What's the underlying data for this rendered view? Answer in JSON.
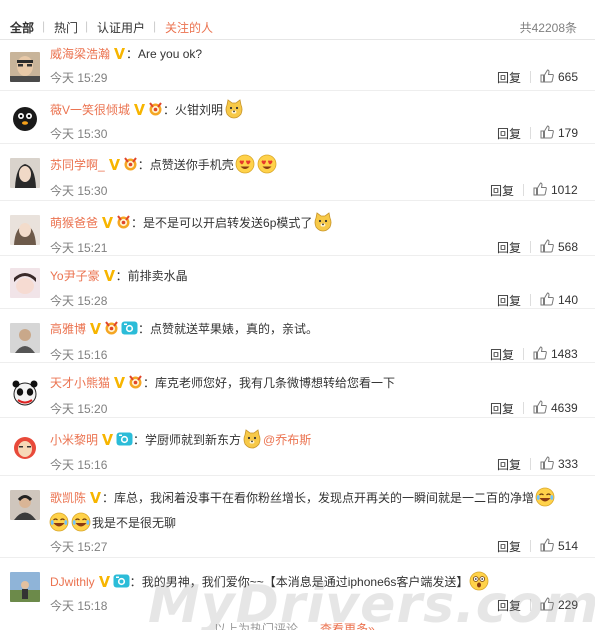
{
  "tabs": {
    "all": "全部",
    "hot": "热门",
    "verified": "认证用户",
    "following": "关注的人",
    "total": "共42208条"
  },
  "comments": [
    {
      "user": "威海梁浩瀚",
      "sep": "：",
      "text": "Are you ok?",
      "time": "今天 15:29",
      "reply": "回复",
      "likes": "665"
    },
    {
      "user": "薇V一笑很倾城",
      "sep": "：",
      "text": "火钳刘明",
      "time": "今天 15:30",
      "reply": "回复",
      "likes": "179"
    },
    {
      "user": "苏同学啊_",
      "sep": "：",
      "text": "点赞送你手机壳",
      "time": "今天 15:30",
      "reply": "回复",
      "likes": "1012"
    },
    {
      "user": "萌猴爸爸",
      "sep": "：",
      "text": "是不是可以开启转发送6p模式了",
      "time": "今天 15:21",
      "reply": "回复",
      "likes": "568"
    },
    {
      "user": "Yo尹子豪",
      "sep": "：",
      "text": "前排卖水晶",
      "time": "今天 15:28",
      "reply": "回复",
      "likes": "140"
    },
    {
      "user": "高雅博",
      "sep": "：",
      "text": "点赞就送苹果婊，真的，亲试。",
      "time": "今天 15:16",
      "reply": "回复",
      "likes": "1483"
    },
    {
      "user": "天才小熊猫",
      "sep": "：",
      "text": "库克老师您好，我有几条微博想转给您看一下",
      "time": "今天 15:20",
      "reply": "回复",
      "likes": "4639"
    },
    {
      "user": "小米黎明",
      "sep": "：",
      "text": "学厨师就到新东方",
      "mention": "@乔布斯",
      "time": "今天 15:16",
      "reply": "回复",
      "likes": "333"
    },
    {
      "user": "歌凯陈",
      "sep": "：",
      "text": "库总，我闲着没事干在看你粉丝增长，发现点开再关的一瞬间就是一二百的净增",
      "text2": "我是不是很无聊",
      "time": "今天 15:27",
      "reply": "回复",
      "likes": "514"
    },
    {
      "user": "DJwithly",
      "sep": "：",
      "text": "我的男神，我们爱你~~【本消息是通过iphone6s客户端发送】",
      "time": "今天 15:18",
      "reply": "回复",
      "likes": "229"
    }
  ],
  "footer": {
    "text": "以上为热门评论，",
    "more": "查看更多»"
  },
  "watermark": "MyDrivers.com",
  "colors": {
    "accent": "#eb7350",
    "vip": "#f7b500",
    "camera": "#2bbcd8"
  }
}
